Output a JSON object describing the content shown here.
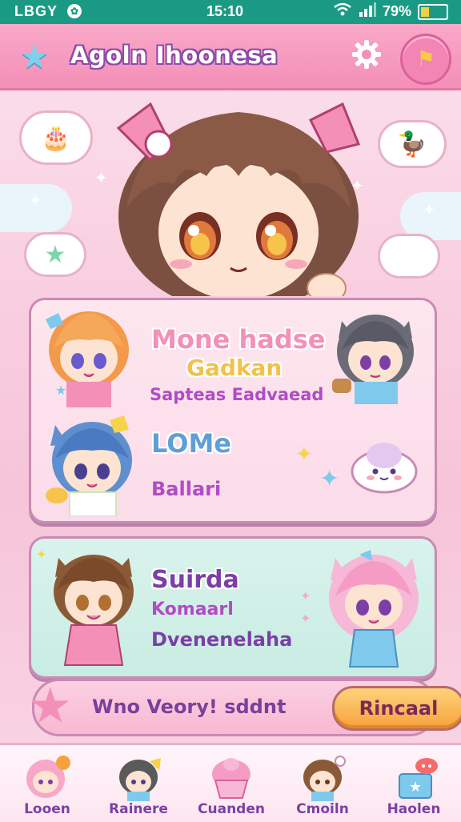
{
  "status_bar": {
    "left_text": "LBGY",
    "time": "15:10",
    "battery": "79%",
    "battery_level": 0.35
  },
  "header": {
    "title": "Agoln Ihoonesa",
    "left_icon": "star-icon",
    "settings_icon": "gear-icon",
    "right_icon": "flag-icon"
  },
  "card1": {
    "line1": "Mone hadse",
    "line2": "Gadkan",
    "line3": "Sapteas Eadvaead",
    "line4": "LOMe",
    "line5": "Ballari"
  },
  "card2": {
    "line1": "Suirda",
    "line2": "Komaarl",
    "line3": "Dvenenelaha"
  },
  "action_bar": {
    "text": "Wno Veory!  sddnt",
    "button": "Rincaal"
  },
  "bottom_nav": {
    "items": [
      {
        "label": "Looen"
      },
      {
        "label": "Rainere"
      },
      {
        "label": "Cuanden"
      },
      {
        "label": "Cmoiln"
      },
      {
        "label": "Haolen"
      }
    ]
  },
  "colors": {
    "status_bar": "#1a9a84",
    "header": "#f48fb8",
    "card1_bg": "#fbdce9",
    "card2_bg": "#c8ece3",
    "accent_purple": "#7b3fa6",
    "cta_orange": "#f6a23c"
  }
}
